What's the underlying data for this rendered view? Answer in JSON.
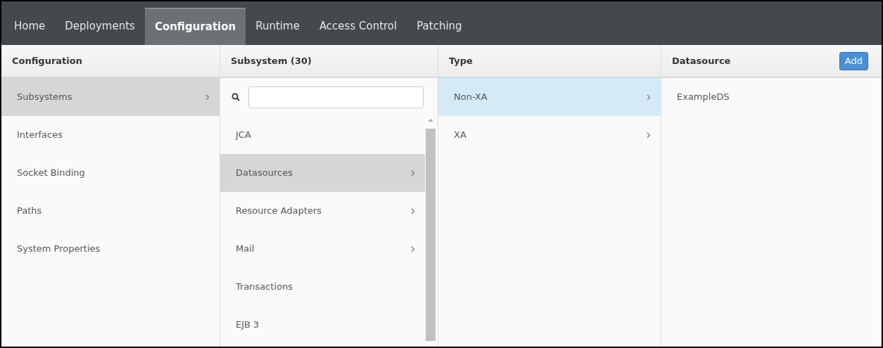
{
  "nav": {
    "tabs": [
      {
        "label": "Home",
        "selected": false
      },
      {
        "label": "Deployments",
        "selected": false
      },
      {
        "label": "Configuration",
        "selected": true
      },
      {
        "label": "Runtime",
        "selected": false
      },
      {
        "label": "Access Control",
        "selected": false
      },
      {
        "label": "Patching",
        "selected": false
      }
    ]
  },
  "columns": [
    {
      "title": "Configuration",
      "items": [
        {
          "label": "Subsystems",
          "selected": true,
          "has_children": true
        },
        {
          "label": "Interfaces",
          "selected": false,
          "has_children": false
        },
        {
          "label": "Socket Binding",
          "selected": false,
          "has_children": false
        },
        {
          "label": "Paths",
          "selected": false,
          "has_children": false
        },
        {
          "label": "System Properties",
          "selected": false,
          "has_children": false
        }
      ]
    },
    {
      "title": "Subsystem (30)",
      "has_search": true,
      "items": [
        {
          "label": "JCA",
          "selected": false,
          "has_children": false
        },
        {
          "label": "Datasources",
          "selected": true,
          "has_children": true
        },
        {
          "label": "Resource Adapters",
          "selected": false,
          "has_children": true
        },
        {
          "label": "Mail",
          "selected": false,
          "has_children": true
        },
        {
          "label": "Transactions",
          "selected": false,
          "has_children": false
        },
        {
          "label": "EJB 3",
          "selected": false,
          "has_children": false
        }
      ]
    },
    {
      "title": "Type",
      "items": [
        {
          "label": "Non-XA",
          "selected": true,
          "has_children": true
        },
        {
          "label": "XA",
          "selected": false,
          "has_children": true
        }
      ]
    },
    {
      "title": "Datasource",
      "button": "Add",
      "items": [
        {
          "label": "ExampleDS",
          "selected": false,
          "has_children": false
        }
      ]
    }
  ]
}
